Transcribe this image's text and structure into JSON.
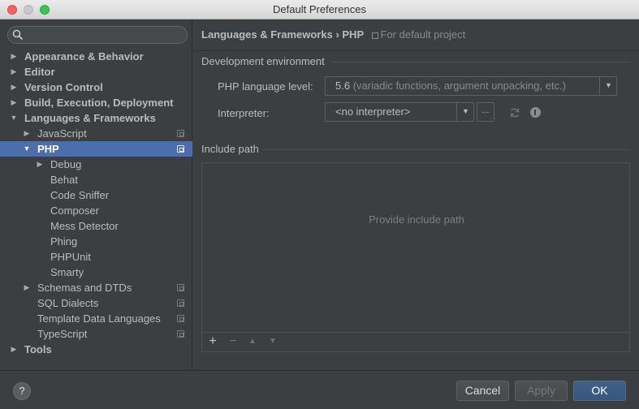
{
  "window": {
    "title": "Default Preferences"
  },
  "search": {
    "placeholder": ""
  },
  "sidebar": {
    "items": [
      {
        "label": "Appearance & Behavior",
        "level": 0,
        "bold": true,
        "arrow": "▶"
      },
      {
        "label": "Editor",
        "level": 0,
        "bold": true,
        "arrow": "▶"
      },
      {
        "label": "Version Control",
        "level": 0,
        "bold": true,
        "arrow": "▶"
      },
      {
        "label": "Build, Execution, Deployment",
        "level": 0,
        "bold": true,
        "arrow": "▶"
      },
      {
        "label": "Languages & Frameworks",
        "level": 0,
        "bold": true,
        "arrow": "▼"
      },
      {
        "label": "JavaScript",
        "level": 1,
        "arrow": "▶",
        "project_icon": true
      },
      {
        "label": "PHP",
        "level": 1,
        "bold": true,
        "arrow": "▼",
        "selected": true,
        "project_icon": true
      },
      {
        "label": "Debug",
        "level": 2,
        "arrow": "▶"
      },
      {
        "label": "Behat",
        "level": 2
      },
      {
        "label": "Code Sniffer",
        "level": 2
      },
      {
        "label": "Composer",
        "level": 2
      },
      {
        "label": "Mess Detector",
        "level": 2
      },
      {
        "label": "Phing",
        "level": 2
      },
      {
        "label": "PHPUnit",
        "level": 2
      },
      {
        "label": "Smarty",
        "level": 2
      },
      {
        "label": "Schemas and DTDs",
        "level": 1,
        "arrow": "▶",
        "project_icon": true
      },
      {
        "label": "SQL Dialects",
        "level": 1,
        "project_icon": true
      },
      {
        "label": "Template Data Languages",
        "level": 1,
        "project_icon": true
      },
      {
        "label": "TypeScript",
        "level": 1,
        "project_icon": true
      },
      {
        "label": "Tools",
        "level": 0,
        "bold": true,
        "arrow": "▶"
      }
    ]
  },
  "main": {
    "breadcrumb": {
      "path": "Languages & Frameworks › PHP",
      "hint": "For default project"
    },
    "dev_env": {
      "title": "Development environment",
      "php_level_label": "PHP language level:",
      "php_level_value": "5.6",
      "php_level_desc": "(variadic functions, argument unpacking, etc.)",
      "interpreter_label": "Interpreter:",
      "interpreter_value": "<no interpreter>",
      "dots_label": "..."
    },
    "include_path": {
      "title": "Include path",
      "empty_text": "Provide include path",
      "toolbar": {
        "add": "+",
        "remove": "−",
        "up": "▲",
        "down": "▼"
      }
    }
  },
  "footer": {
    "help": "?",
    "cancel": "Cancel",
    "apply": "Apply",
    "ok": "OK"
  },
  "colors": {
    "background": "#3c3f41",
    "selection": "#4b6eaf",
    "primary_button": "#365880",
    "text": "#bbbbbb"
  }
}
